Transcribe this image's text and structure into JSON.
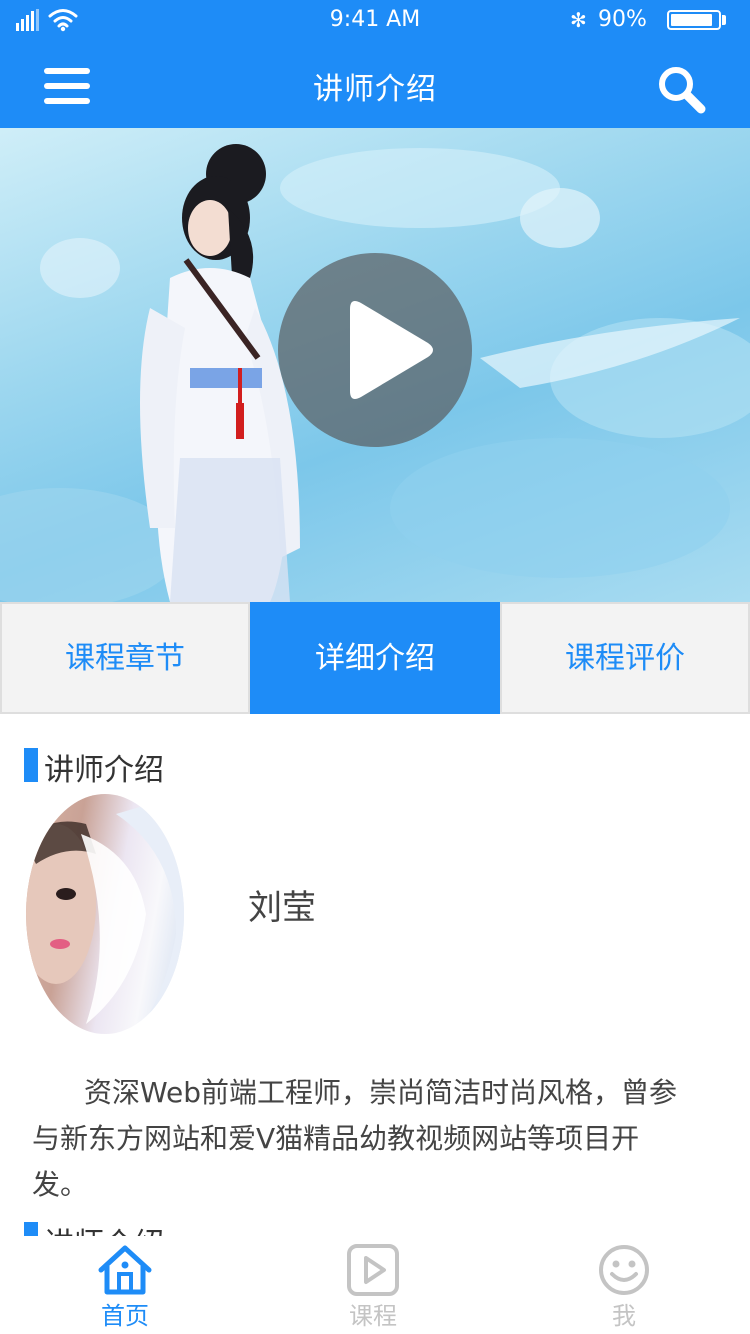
{
  "status_bar": {
    "time": "9:41 AM",
    "battery": "90%",
    "battery_level": 0.9,
    "bluetooth": "✻"
  },
  "navbar": {
    "title": "讲师介绍",
    "menu_icon": "menu-icon",
    "search_icon": "search-icon"
  },
  "video": {
    "play_icon": "play-icon"
  },
  "tabs": [
    {
      "label": "课程章节",
      "active": false
    },
    {
      "label": "详细介绍",
      "active": true
    },
    {
      "label": "课程评价",
      "active": false
    }
  ],
  "teacher": {
    "section_title": "讲师介绍",
    "name": "刘莹",
    "bio": "资深Web前端工程师，崇尚简洁时尚风格，曾参与新东方网站和爱V猫精品幼教视频网站等项目开发。"
  },
  "next_section_title": "讲师介绍",
  "bottom_nav": [
    {
      "label": "首页",
      "icon": "home-icon",
      "active": true
    },
    {
      "label": "课程",
      "icon": "course-play-icon",
      "active": false
    },
    {
      "label": "我",
      "icon": "smile-face-icon",
      "active": false
    }
  ],
  "colors": {
    "primary": "#1e8cf7",
    "inactive": "#c4c4c4",
    "tab_bg": "#f3f3f3"
  }
}
